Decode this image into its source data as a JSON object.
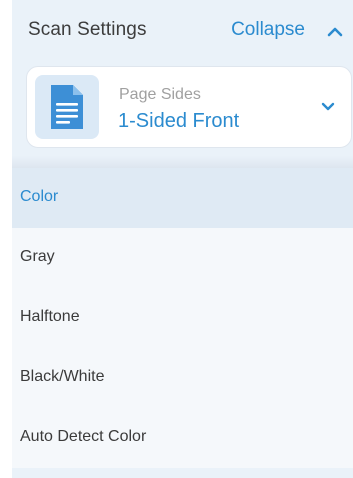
{
  "header": {
    "title": "Scan Settings",
    "collapse_label": "Collapse"
  },
  "page_sides": {
    "label": "Page Sides",
    "value": "1-Sided Front",
    "icon": "document-icon"
  },
  "color_options": {
    "selected": "Color",
    "items": [
      {
        "label": "Color"
      },
      {
        "label": "Gray"
      },
      {
        "label": "Halftone"
      },
      {
        "label": "Black/White"
      },
      {
        "label": "Auto Detect Color"
      }
    ]
  },
  "colors": {
    "accent": "#2b8bcf",
    "panel_bg": "#eaf2f9",
    "dropdown_bg": "#f5f8fb",
    "selected_bg": "#dfeaf4"
  }
}
